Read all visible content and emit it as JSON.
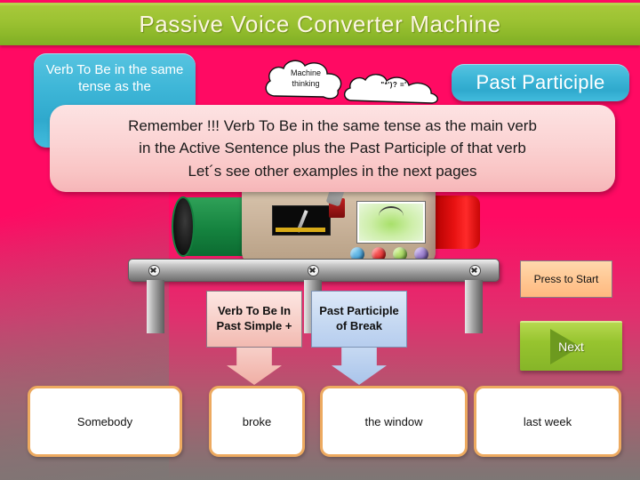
{
  "title": "Passive Voice Converter Machine",
  "boxes": {
    "verb_to_be": "Verb To Be in the same tense as the",
    "past_participle": "Past Participle"
  },
  "clouds": [
    {
      "name": "machine-thinking-cloud",
      "label": "Machine\nthinking"
    },
    {
      "name": "symbols-cloud",
      "label": "\"*')? ='"
    }
  ],
  "remember": {
    "line1": "Remember !!! Verb To Be in the same tense as the main verb",
    "line2": "in  the Active  Sentence plus the Past Participle of that verb",
    "line3": "Let´s see other examples in the next pages"
  },
  "arrows": [
    {
      "name": "arrow-verb-to-be",
      "label": "Verb To Be In Past Simple +",
      "color": "#f7cfc8"
    },
    {
      "name": "arrow-past-participle",
      "label": "Past Participle of Break",
      "color": "#c6d9f2"
    }
  ],
  "cards": [
    {
      "name": "card-somebody",
      "label": "Somebody"
    },
    {
      "name": "card-broke",
      "label": "broke"
    },
    {
      "name": "card-the-window",
      "label": "the  window"
    },
    {
      "name": "card-last-week",
      "label": "last week"
    }
  ],
  "controls": {
    "press_to_start": "Press  to Start",
    "next": "Next"
  },
  "machine_buttons": [
    "blue-button",
    "red-button",
    "green-button",
    "purple-button"
  ],
  "colors": {
    "title_bar": "#9dc333",
    "background_pink": "#ff0a63",
    "blue_box": "#3fb7d8",
    "callout_pink": "#fbd3d3",
    "card_border": "#edaa60",
    "next_button": "#97c42f",
    "press_button": "#ffc894"
  }
}
